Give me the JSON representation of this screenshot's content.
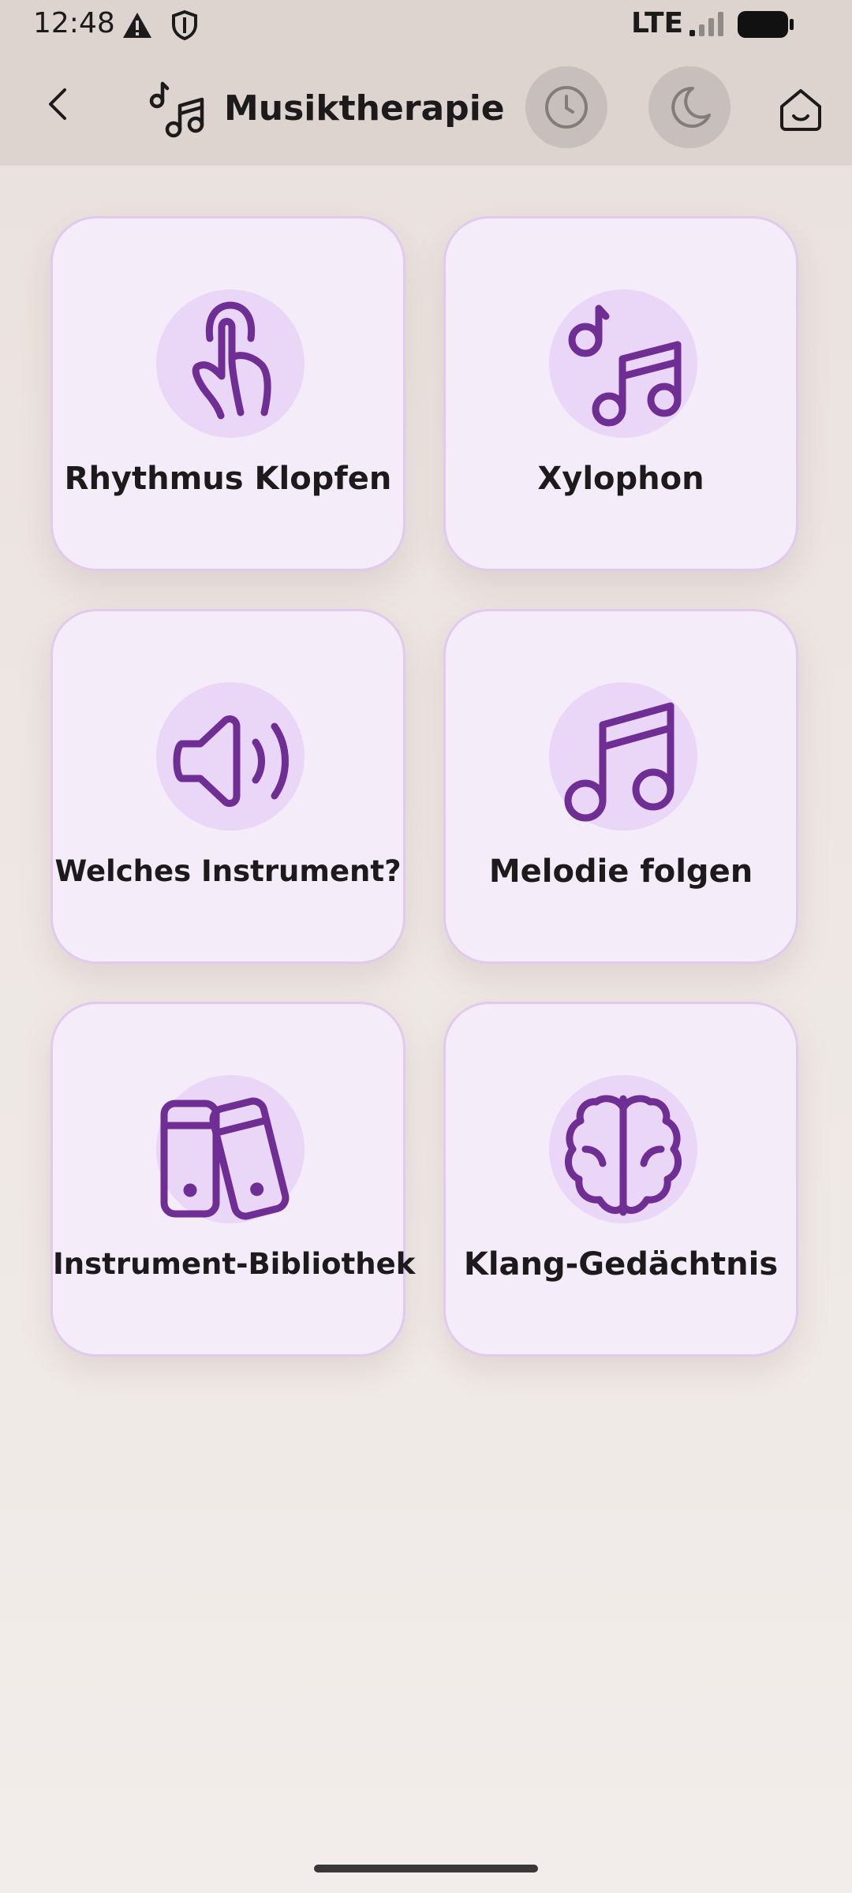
{
  "status_bar": {
    "time": "12:48",
    "network": "LTE",
    "icons": [
      "warning-icon",
      "shield-icon",
      "signal-icon",
      "battery-icon"
    ]
  },
  "header": {
    "title": "Musiktherapie",
    "icons": [
      "back-arrow-icon",
      "music-notes-icon",
      "clock-icon",
      "moon-icon",
      "home-icon"
    ]
  },
  "tiles": [
    {
      "label": "Rhythmus Klopfen",
      "icon": "tap-finger-icon"
    },
    {
      "label": "Xylophon",
      "icon": "music-notes-icon"
    },
    {
      "label": "Welches Instrument?",
      "icon": "speaker-icon"
    },
    {
      "label": "Melodie folgen",
      "icon": "music-note-icon"
    },
    {
      "label": "Instrument-Bibliothek",
      "icon": "library-icon"
    },
    {
      "label": "Klang-Gedächtnis",
      "icon": "brain-icon"
    }
  ],
  "colors": {
    "accent": "#6f2e94",
    "tile_background": "#f5ecf9",
    "tile_border": "#e2c9ee",
    "icon_circle": "#ead6f6",
    "header_background": "#ddd3cf"
  }
}
